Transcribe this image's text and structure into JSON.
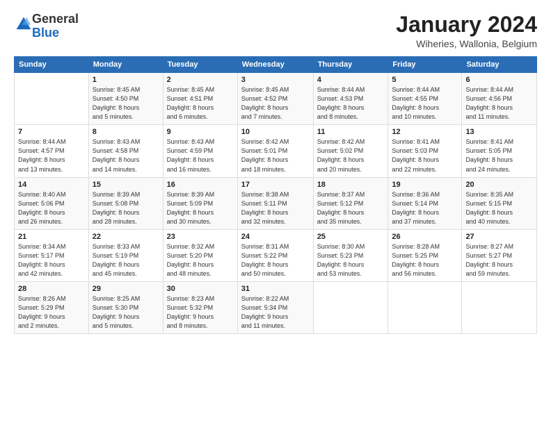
{
  "logo": {
    "general": "General",
    "blue": "Blue"
  },
  "header": {
    "month": "January 2024",
    "location": "Wiheries, Wallonia, Belgium"
  },
  "weekdays": [
    "Sunday",
    "Monday",
    "Tuesday",
    "Wednesday",
    "Thursday",
    "Friday",
    "Saturday"
  ],
  "weeks": [
    [
      {
        "day": "",
        "info": ""
      },
      {
        "day": "1",
        "info": "Sunrise: 8:45 AM\nSunset: 4:50 PM\nDaylight: 8 hours\nand 5 minutes."
      },
      {
        "day": "2",
        "info": "Sunrise: 8:45 AM\nSunset: 4:51 PM\nDaylight: 8 hours\nand 6 minutes."
      },
      {
        "day": "3",
        "info": "Sunrise: 8:45 AM\nSunset: 4:52 PM\nDaylight: 8 hours\nand 7 minutes."
      },
      {
        "day": "4",
        "info": "Sunrise: 8:44 AM\nSunset: 4:53 PM\nDaylight: 8 hours\nand 8 minutes."
      },
      {
        "day": "5",
        "info": "Sunrise: 8:44 AM\nSunset: 4:55 PM\nDaylight: 8 hours\nand 10 minutes."
      },
      {
        "day": "6",
        "info": "Sunrise: 8:44 AM\nSunset: 4:56 PM\nDaylight: 8 hours\nand 11 minutes."
      }
    ],
    [
      {
        "day": "7",
        "info": "Sunrise: 8:44 AM\nSunset: 4:57 PM\nDaylight: 8 hours\nand 13 minutes."
      },
      {
        "day": "8",
        "info": "Sunrise: 8:43 AM\nSunset: 4:58 PM\nDaylight: 8 hours\nand 14 minutes."
      },
      {
        "day": "9",
        "info": "Sunrise: 8:43 AM\nSunset: 4:59 PM\nDaylight: 8 hours\nand 16 minutes."
      },
      {
        "day": "10",
        "info": "Sunrise: 8:42 AM\nSunset: 5:01 PM\nDaylight: 8 hours\nand 18 minutes."
      },
      {
        "day": "11",
        "info": "Sunrise: 8:42 AM\nSunset: 5:02 PM\nDaylight: 8 hours\nand 20 minutes."
      },
      {
        "day": "12",
        "info": "Sunrise: 8:41 AM\nSunset: 5:03 PM\nDaylight: 8 hours\nand 22 minutes."
      },
      {
        "day": "13",
        "info": "Sunrise: 8:41 AM\nSunset: 5:05 PM\nDaylight: 8 hours\nand 24 minutes."
      }
    ],
    [
      {
        "day": "14",
        "info": "Sunrise: 8:40 AM\nSunset: 5:06 PM\nDaylight: 8 hours\nand 26 minutes."
      },
      {
        "day": "15",
        "info": "Sunrise: 8:39 AM\nSunset: 5:08 PM\nDaylight: 8 hours\nand 28 minutes."
      },
      {
        "day": "16",
        "info": "Sunrise: 8:39 AM\nSunset: 5:09 PM\nDaylight: 8 hours\nand 30 minutes."
      },
      {
        "day": "17",
        "info": "Sunrise: 8:38 AM\nSunset: 5:11 PM\nDaylight: 8 hours\nand 32 minutes."
      },
      {
        "day": "18",
        "info": "Sunrise: 8:37 AM\nSunset: 5:12 PM\nDaylight: 8 hours\nand 35 minutes."
      },
      {
        "day": "19",
        "info": "Sunrise: 8:36 AM\nSunset: 5:14 PM\nDaylight: 8 hours\nand 37 minutes."
      },
      {
        "day": "20",
        "info": "Sunrise: 8:35 AM\nSunset: 5:15 PM\nDaylight: 8 hours\nand 40 minutes."
      }
    ],
    [
      {
        "day": "21",
        "info": "Sunrise: 8:34 AM\nSunset: 5:17 PM\nDaylight: 8 hours\nand 42 minutes."
      },
      {
        "day": "22",
        "info": "Sunrise: 8:33 AM\nSunset: 5:19 PM\nDaylight: 8 hours\nand 45 minutes."
      },
      {
        "day": "23",
        "info": "Sunrise: 8:32 AM\nSunset: 5:20 PM\nDaylight: 8 hours\nand 48 minutes."
      },
      {
        "day": "24",
        "info": "Sunrise: 8:31 AM\nSunset: 5:22 PM\nDaylight: 8 hours\nand 50 minutes."
      },
      {
        "day": "25",
        "info": "Sunrise: 8:30 AM\nSunset: 5:23 PM\nDaylight: 8 hours\nand 53 minutes."
      },
      {
        "day": "26",
        "info": "Sunrise: 8:28 AM\nSunset: 5:25 PM\nDaylight: 8 hours\nand 56 minutes."
      },
      {
        "day": "27",
        "info": "Sunrise: 8:27 AM\nSunset: 5:27 PM\nDaylight: 8 hours\nand 59 minutes."
      }
    ],
    [
      {
        "day": "28",
        "info": "Sunrise: 8:26 AM\nSunset: 5:29 PM\nDaylight: 9 hours\nand 2 minutes."
      },
      {
        "day": "29",
        "info": "Sunrise: 8:25 AM\nSunset: 5:30 PM\nDaylight: 9 hours\nand 5 minutes."
      },
      {
        "day": "30",
        "info": "Sunrise: 8:23 AM\nSunset: 5:32 PM\nDaylight: 9 hours\nand 8 minutes."
      },
      {
        "day": "31",
        "info": "Sunrise: 8:22 AM\nSunset: 5:34 PM\nDaylight: 9 hours\nand 11 minutes."
      },
      {
        "day": "",
        "info": ""
      },
      {
        "day": "",
        "info": ""
      },
      {
        "day": "",
        "info": ""
      }
    ]
  ]
}
